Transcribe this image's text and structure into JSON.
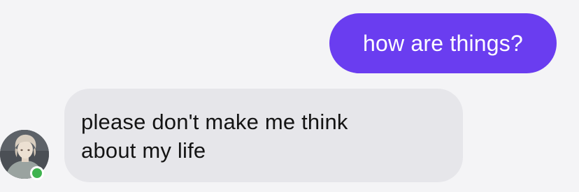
{
  "messages": {
    "outgoing": {
      "text": "how are things?",
      "bubble_color": "#6a3df0",
      "text_color": "#ffffff"
    },
    "incoming": {
      "lines": [
        "please don't make me think",
        "about my life"
      ],
      "bubble_color": "#e6e6ea",
      "text_color": "#141414"
    }
  },
  "contact": {
    "avatar_icon": "person-avatar",
    "online": true,
    "presence_color": "#3fb34f"
  }
}
